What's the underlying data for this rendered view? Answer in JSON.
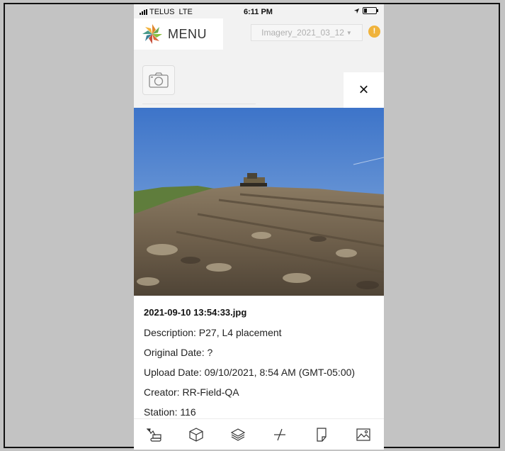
{
  "status_bar": {
    "carrier": "TELUS",
    "network": "LTE",
    "time": "6:11 PM"
  },
  "header": {
    "menu_label": "MENU",
    "imagery_select": "Imagery_2021_03_12",
    "warning_glyph": "!"
  },
  "close_glyph": "×",
  "photo": {
    "filename": "2021-09-10 13:54:33.jpg",
    "description": "Description: P27, L4 placement",
    "original_date": "Original Date: ?",
    "upload_date": "Upload Date: 09/10/2021, 8:54 AM (GMT-05:00)",
    "creator": "Creator: RR-Field-QA",
    "station": "Station: 116"
  },
  "toolbar": {
    "tools": [
      "excavator-icon",
      "cube-icon",
      "layers-icon",
      "measure-icon",
      "document-icon",
      "image-icon"
    ]
  },
  "colors": {
    "background": "#c3c3c3",
    "warning": "#f0b33c",
    "logo_orange": "#e0892f",
    "logo_green": "#8bbf3f",
    "logo_red": "#c8503c",
    "logo_teal": "#4a9a8a"
  }
}
